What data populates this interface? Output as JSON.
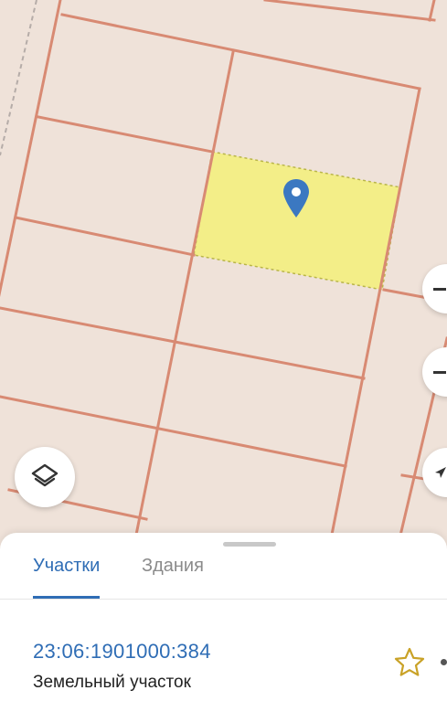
{
  "map": {
    "selected_plot_color": "#f3ee88",
    "plot_line_color": "#d88a73",
    "background_color": "#efe2d9",
    "marker_color": "#3b78c1",
    "marker_icon": "location-pin-icon"
  },
  "controls": {
    "zoom_in_icon": "zoom-in-icon",
    "zoom_out_icon": "zoom-out-icon",
    "locate_icon": "navigate-arrow-icon",
    "layers_icon": "layers-icon"
  },
  "bottom_sheet": {
    "tabs": [
      {
        "label": "Участки",
        "active": true
      },
      {
        "label": "Здания",
        "active": false
      }
    ],
    "accent_color": "#2f6db5",
    "result": {
      "cadastral_number": "23:06:1901000:384",
      "type": "Земельный участок",
      "favorite_icon": "star-icon"
    }
  }
}
